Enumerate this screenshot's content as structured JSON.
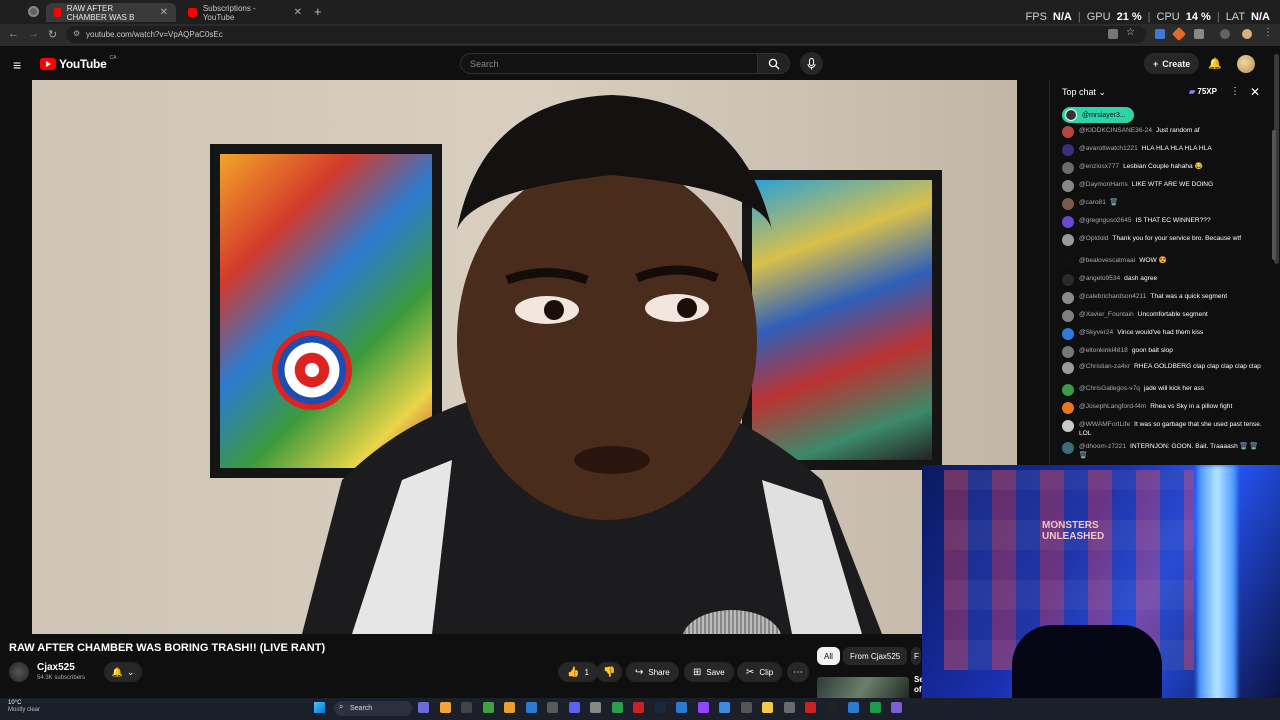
{
  "browser": {
    "tabs": [
      {
        "title": "RAW AFTER CHAMBER WAS B",
        "active": true
      },
      {
        "title": "Subscriptions - YouTube",
        "active": false
      }
    ],
    "url": "youtube.com/watch?v=VpAQPaC0sEc",
    "new_tab": "+",
    "close_glyph": "✕"
  },
  "overlay_metrics": [
    {
      "key": "FPS",
      "value": "N/A"
    },
    {
      "key": "GPU",
      "value": "21 %"
    },
    {
      "key": "CPU",
      "value": "14 %"
    },
    {
      "key": "LAT",
      "value": "N/A"
    }
  ],
  "youtube": {
    "logo": "YouTube",
    "country": "CA",
    "search_placeholder": "Search",
    "create_label": "Create"
  },
  "video": {
    "title": "RAW AFTER CHAMBER WAS BORING TRASH!! (LIVE RANT)",
    "channel": "Cjax525",
    "subscribers": "54.3K subscribers",
    "likes": "1",
    "share_label": "Share",
    "save_label": "Save",
    "clip_label": "Clip"
  },
  "chips": [
    "All",
    "From Cjax525",
    "F"
  ],
  "recommended": {
    "title_line1": "Se",
    "title_line2": "of"
  },
  "chat": {
    "header": "Top chat",
    "xp": "75XP",
    "pinned_user": "@mrslayer3...",
    "messages": [
      {
        "user": "@KIDDKCINSANE36-24",
        "text": "Just random af",
        "color": "#b3473f"
      },
      {
        "user": "@avarottwatch1221",
        "text": "HLA HLA HLA HLA HLA",
        "color": "#3b2f7a"
      },
      {
        "user": "@enziosx777",
        "text": "Lesbian Couple hahaha 😂",
        "color": "#6a6a6a"
      },
      {
        "user": "@DaymonHarris",
        "text": "LIKE WTF ARE WE DOING",
        "color": "#888888"
      },
      {
        "user": "@caro81",
        "text": "🗑️",
        "color": "#7a5a48"
      },
      {
        "user": "@gregnguso2645",
        "text": "IS THAT EC WINNER???",
        "color": "#6b4ad1"
      },
      {
        "user": "@Opldold",
        "text": "Thank you for your service bro. Because wtf",
        "color": "#9a9a9a"
      },
      {
        "user": "@bealovescatmaal",
        "text": "WOW 😍",
        "color": "#111111"
      },
      {
        "user": "@angelo9534",
        "text": "dash agree",
        "color": "#2a2a2a"
      },
      {
        "user": "@calebrichardson4211",
        "text": "That was a quick segment",
        "color": "#8a8a8a"
      },
      {
        "user": "@Xavier_Fountain",
        "text": "Uncomfortable segment",
        "color": "#7f7f7f"
      },
      {
        "user": "@Skyver24",
        "text": "Vince would've had them kiss",
        "color": "#2f7bdc"
      },
      {
        "user": "@eltonkinkl4818",
        "text": "goon bait slop",
        "color": "#777777"
      },
      {
        "user": "@Christian-za4xr",
        "text": "RHEA GOLDBERG clap clap clap clap clap",
        "color": "#9a9a9a"
      },
      {
        "user": "@ChrisGallegos-v7q",
        "text": "jade will kick her ass",
        "color": "#3a9b4a"
      },
      {
        "user": "@JosephLangford-f4m",
        "text": "Rhea vs Sky in a pillow fight",
        "color": "#e8761a"
      },
      {
        "user": "@WWAMFortLife",
        "text": "It was so garbage that she used past tense. LOL",
        "color": "#c9c9c9"
      },
      {
        "user": "@dhoom-z7221",
        "text": "INTERNJON: GOON. Bait. Traaaash 🗑️ 🗑️ 🗑️",
        "color": "#3c6c7a"
      }
    ]
  },
  "webcam": {
    "poster_text_1": "MONSTERS",
    "poster_text_2": "UNLEASHED"
  },
  "taskbar": {
    "weather_temp": "10°C",
    "weather_desc": "Mostly clear",
    "search_label": "Search"
  },
  "colors": {
    "youtube_red": "#ff0000",
    "chat_pinned": "#2dd4a7"
  }
}
